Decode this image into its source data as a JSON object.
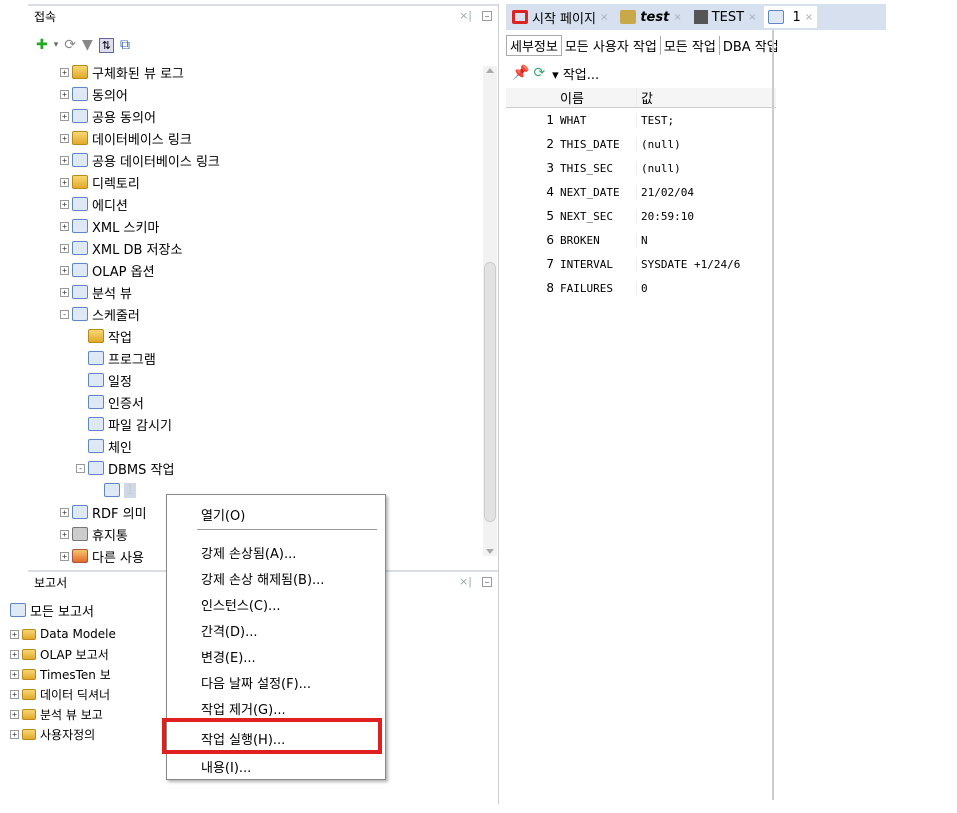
{
  "connections_panel": {
    "title": "접속",
    "tree": [
      {
        "label": "구체화된 뷰 로그",
        "expander": "+"
      },
      {
        "label": "동의어",
        "expander": "+"
      },
      {
        "label": "공용 동의어",
        "expander": "+"
      },
      {
        "label": "데이터베이스 링크",
        "expander": "+"
      },
      {
        "label": "공용 데이터베이스 링크",
        "expander": "+"
      },
      {
        "label": "디렉토리",
        "expander": "+"
      },
      {
        "label": "에디션",
        "expander": "+"
      },
      {
        "label": "XML 스키마",
        "expander": "+"
      },
      {
        "label": "XML DB 저장소",
        "expander": "+"
      },
      {
        "label": "OLAP 옵션",
        "expander": "+"
      },
      {
        "label": "분석 뷰",
        "expander": "+"
      },
      {
        "label": "스케줄러",
        "expander": "-"
      },
      {
        "label": "작업",
        "expander": ""
      },
      {
        "label": "프로그램",
        "expander": ""
      },
      {
        "label": "일정",
        "expander": ""
      },
      {
        "label": "인증서",
        "expander": ""
      },
      {
        "label": "파일 감시기",
        "expander": ""
      },
      {
        "label": "체인",
        "expander": ""
      },
      {
        "label": "DBMS 작업",
        "expander": "-"
      },
      {
        "label": "1",
        "expander": ""
      },
      {
        "label": "RDF 의미",
        "expander": "+"
      },
      {
        "label": "휴지통",
        "expander": "+"
      },
      {
        "label": "다른 사용",
        "expander": "+"
      }
    ]
  },
  "reports_panel": {
    "title": "보고서",
    "root": "모든 보고서",
    "items": [
      "Data Modele",
      "OLAP 보고서",
      "TimesTen 보",
      "데이터 딕셔너",
      "분석 뷰 보고",
      "사용자정의"
    ]
  },
  "editor": {
    "tabs": [
      {
        "label": "시작 페이지",
        "icon": "oracle-icon"
      },
      {
        "label": "test",
        "icon": "sql-worksheet-icon"
      },
      {
        "label": "TEST",
        "icon": "database-icon"
      },
      {
        "label": "1",
        "icon": "scheduler-job-icon"
      }
    ],
    "subtabs": [
      "세부정보",
      "모든 사용자 작업",
      "모든 작업",
      "DBA 작업"
    ],
    "actions_label": "▾ 작업...",
    "grid_headers": {
      "name": "이름",
      "value": "값"
    },
    "rows": [
      {
        "n": "1",
        "name": "WHAT",
        "value": "TEST;"
      },
      {
        "n": "2",
        "name": "THIS_DATE",
        "value": "(null)"
      },
      {
        "n": "3",
        "name": "THIS_SEC",
        "value": "(null)"
      },
      {
        "n": "4",
        "name": "NEXT_DATE",
        "value": "21/02/04"
      },
      {
        "n": "5",
        "name": "NEXT_SEC",
        "value": "20:59:10"
      },
      {
        "n": "6",
        "name": "BROKEN",
        "value": "N"
      },
      {
        "n": "7",
        "name": "INTERVAL",
        "value": "SYSDATE +1/24/6"
      },
      {
        "n": "8",
        "name": "FAILURES",
        "value": "0"
      }
    ]
  },
  "context_menu": {
    "items": [
      "열기(O)",
      "강제 손상됨(A)...",
      "강제 손상 해제됨(B)...",
      "인스턴스(C)...",
      "간격(D)...",
      "변경(E)...",
      "다음 날짜 설정(F)...",
      "작업 제거(G)...",
      "작업 실행(H)...",
      "내용(I)..."
    ],
    "highlight_color": "#e02020"
  }
}
